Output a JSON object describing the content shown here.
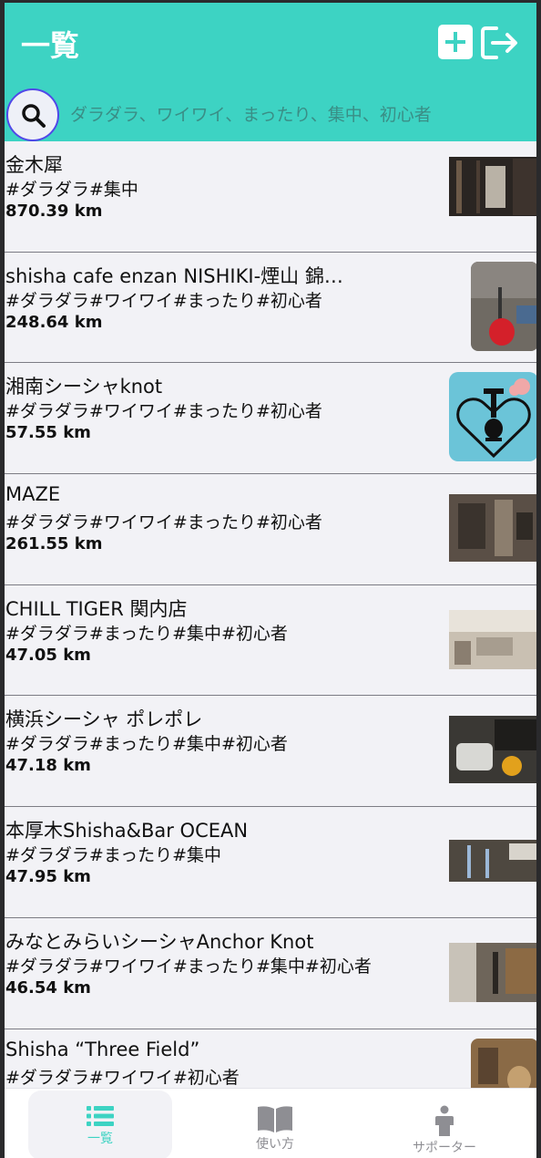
{
  "header": {
    "title": "一覧",
    "search_placeholder": "ダラダラ、ワイワイ、まったり、集中、初心者"
  },
  "colors": {
    "accent": "#3dd3c3",
    "search_ring": "#5148e8",
    "background": "#f2f2f6"
  },
  "icons": {
    "add": "plus-square-icon",
    "logout": "logout-icon",
    "search": "search-icon",
    "list": "list-icon",
    "howto": "book-icon",
    "supporter": "person-icon"
  },
  "shops": [
    {
      "name": "金木犀",
      "tags": "#ダラダラ#集中",
      "distance": "870.39 km"
    },
    {
      "name": "shisha cafe enzan NISHIKI-煙山 錦…",
      "tags": "#ダラダラ#ワイワイ#まったり#初心者",
      "distance": "248.64 km"
    },
    {
      "name": "湘南シーシャknot",
      "tags": "#ダラダラ#ワイワイ#まったり#初心者",
      "distance": "57.55 km"
    },
    {
      "name": "MAZE",
      "tags": "#ダラダラ#ワイワイ#まったり#初心者",
      "distance": "261.55 km"
    },
    {
      "name": "CHILL TIGER 関内店",
      "tags": "#ダラダラ#まったり#集中#初心者",
      "distance": "47.05 km"
    },
    {
      "name": "横浜シーシャ ポレポレ",
      "tags": "#ダラダラ#まったり#集中#初心者",
      "distance": "47.18 km"
    },
    {
      "name": "本厚木Shisha&Bar OCEAN",
      "tags": "#ダラダラ#まったり#集中",
      "distance": "47.95 km"
    },
    {
      "name": "みなとみらいシーシャAnchor Knot",
      "tags": "#ダラダラ#ワイワイ#まったり#集中#初心者",
      "distance": "46.54 km"
    },
    {
      "name": "Shisha “Three Field”",
      "tags": "#ダラダラ#ワイワイ#初心者",
      "distance": ""
    }
  ],
  "nav": {
    "list_label": "一覧",
    "howto_label": "使い方",
    "supporter_label": "サポーター"
  }
}
